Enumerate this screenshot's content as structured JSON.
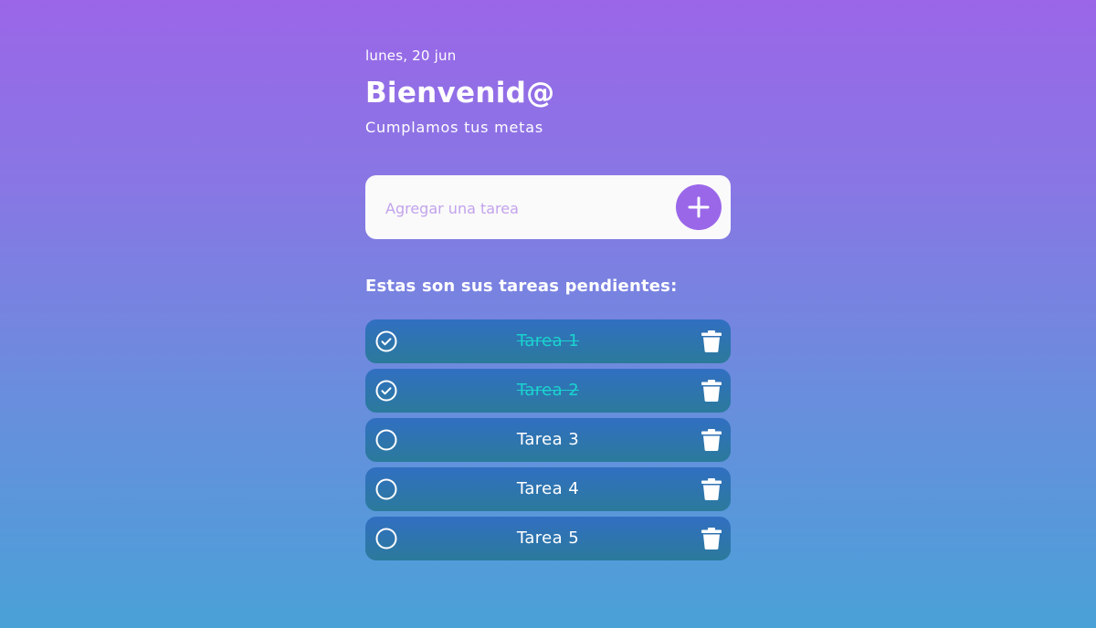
{
  "header": {
    "date": "lunes, 20 jun",
    "title": "Bienvenid@",
    "subtitle": "Cumplamos tus metas"
  },
  "add_task": {
    "placeholder": "Agregar una tarea",
    "button_icon": "plus-icon"
  },
  "pending_title": "Estas son sus tareas pendientes:",
  "tasks": [
    {
      "label": "Tarea 1",
      "completed": true
    },
    {
      "label": "Tarea 2",
      "completed": true
    },
    {
      "label": "Tarea 3",
      "completed": false
    },
    {
      "label": "Tarea 4",
      "completed": false
    },
    {
      "label": "Tarea 5",
      "completed": false
    }
  ],
  "colors": {
    "accent": "#9a67e9",
    "completed_text": "#1ad3cf",
    "task_bg": "#2f73b6"
  },
  "icons": {
    "completed": "check-circle-icon",
    "pending": "circle-icon",
    "delete": "trash-icon"
  }
}
